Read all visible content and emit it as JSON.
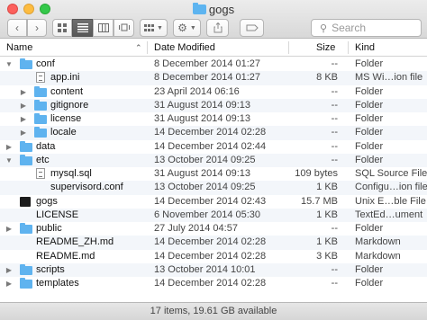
{
  "window": {
    "title": "gogs"
  },
  "toolbar": {
    "back_icon": "chevron-left-icon",
    "forward_icon": "chevron-right-icon",
    "view_modes": [
      "icon-view",
      "list-view",
      "column-view",
      "coverflow-view"
    ],
    "active_view": "list-view",
    "search_placeholder": "Search"
  },
  "columns": {
    "name": "Name",
    "date": "Date Modified",
    "size": "Size",
    "kind": "Kind"
  },
  "rows": [
    {
      "name": "conf",
      "date": "8 December 2014 01:27",
      "size": "--",
      "kind": "Folder",
      "type": "folder",
      "level": 0,
      "disclosure": "open"
    },
    {
      "name": "app.ini",
      "date": "8 December 2014 01:27",
      "size": "8 KB",
      "kind": "MS Wi…ion file",
      "type": "doc",
      "level": 1,
      "disclosure": "none"
    },
    {
      "name": "content",
      "date": "23 April 2014 06:16",
      "size": "--",
      "kind": "Folder",
      "type": "folder",
      "level": 1,
      "disclosure": "closed"
    },
    {
      "name": "gitignore",
      "date": "31 August 2014 09:13",
      "size": "--",
      "kind": "Folder",
      "type": "folder",
      "level": 1,
      "disclosure": "closed"
    },
    {
      "name": "license",
      "date": "31 August 2014 09:13",
      "size": "--",
      "kind": "Folder",
      "type": "folder",
      "level": 1,
      "disclosure": "closed"
    },
    {
      "name": "locale",
      "date": "14 December 2014 02:28",
      "size": "--",
      "kind": "Folder",
      "type": "folder",
      "level": 1,
      "disclosure": "closed"
    },
    {
      "name": "data",
      "date": "14 December 2014 02:44",
      "size": "--",
      "kind": "Folder",
      "type": "folder",
      "level": 0,
      "disclosure": "closed"
    },
    {
      "name": "etc",
      "date": "13 October 2014 09:25",
      "size": "--",
      "kind": "Folder",
      "type": "folder",
      "level": 0,
      "disclosure": "open"
    },
    {
      "name": "mysql.sql",
      "date": "31 August 2014 09:13",
      "size": "109 bytes",
      "kind": "SQL Source File",
      "type": "doc",
      "level": 1,
      "disclosure": "none"
    },
    {
      "name": "supervisord.conf",
      "date": "13 October 2014 09:25",
      "size": "1 KB",
      "kind": "Configu…ion file",
      "type": "plain",
      "level": 1,
      "disclosure": "none"
    },
    {
      "name": "gogs",
      "date": "14 December 2014 02:43",
      "size": "15.7 MB",
      "kind": "Unix E…ble File",
      "type": "exec",
      "level": 0,
      "disclosure": "none"
    },
    {
      "name": "LICENSE",
      "date": "6 November 2014 05:30",
      "size": "1 KB",
      "kind": "TextEd…ument",
      "type": "plain",
      "level": 0,
      "disclosure": "none"
    },
    {
      "name": "public",
      "date": "27 July 2014 04:57",
      "size": "--",
      "kind": "Folder",
      "type": "folder",
      "level": 0,
      "disclosure": "closed"
    },
    {
      "name": "README_ZH.md",
      "date": "14 December 2014 02:28",
      "size": "1 KB",
      "kind": "Markdown",
      "type": "plain",
      "level": 0,
      "disclosure": "none"
    },
    {
      "name": "README.md",
      "date": "14 December 2014 02:28",
      "size": "3 KB",
      "kind": "Markdown",
      "type": "plain",
      "level": 0,
      "disclosure": "none"
    },
    {
      "name": "scripts",
      "date": "13 October 2014 10:01",
      "size": "--",
      "kind": "Folder",
      "type": "folder",
      "level": 0,
      "disclosure": "closed"
    },
    {
      "name": "templates",
      "date": "14 December 2014 02:28",
      "size": "--",
      "kind": "Folder",
      "type": "folder",
      "level": 0,
      "disclosure": "closed"
    }
  ],
  "status": {
    "text": "17 items, 19.61 GB available"
  }
}
